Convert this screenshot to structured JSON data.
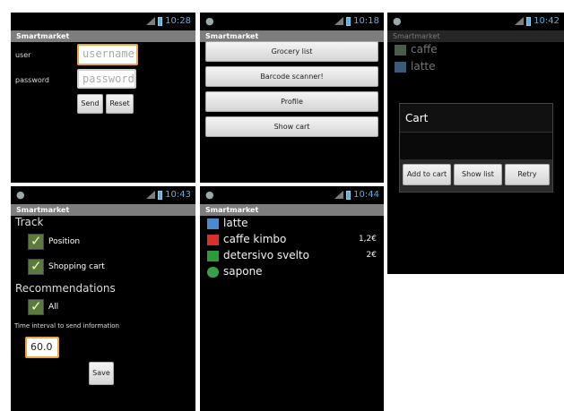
{
  "status_times": [
    "10:28",
    "10:18",
    "10:42",
    "10:43",
    "10:44"
  ],
  "app_title": "Smartmarket",
  "login": {
    "user_label": "user",
    "password_label": "password",
    "username_placeholder": "username",
    "password_placeholder": "password",
    "send": "Send",
    "reset": "Reset"
  },
  "menu": {
    "items": [
      "Grocery list",
      "Barcode scanner!",
      "Profile",
      "Show cart"
    ]
  },
  "cart_dialog": {
    "bg_items": [
      "caffe",
      "latte"
    ],
    "title": "Cart",
    "buttons": [
      "Add to cart",
      "Show list",
      "Retry"
    ]
  },
  "settings": {
    "track_heading": "Track",
    "position": "Position",
    "shopping_cart": "Shopping cart",
    "recommendations_heading": "Recommendations",
    "all": "All",
    "interval_label": "Time interval to send information",
    "interval_value": "60.0",
    "save": "Save"
  },
  "product_list": [
    {
      "name": "latte",
      "price": "",
      "icon": "milk-icon"
    },
    {
      "name": "caffe kimbo",
      "price": "1,2€",
      "icon": "coffee-pack-icon"
    },
    {
      "name": "detersivo svelto",
      "price": "2€",
      "icon": "detergent-icon"
    },
    {
      "name": "sapone",
      "price": "",
      "icon": "soap-icon"
    }
  ],
  "colors": {
    "accent": "#5aaeea",
    "titlebar": "#7d7d7d",
    "focus_border": "#f0a640",
    "checkbox": "#5c7a40"
  }
}
